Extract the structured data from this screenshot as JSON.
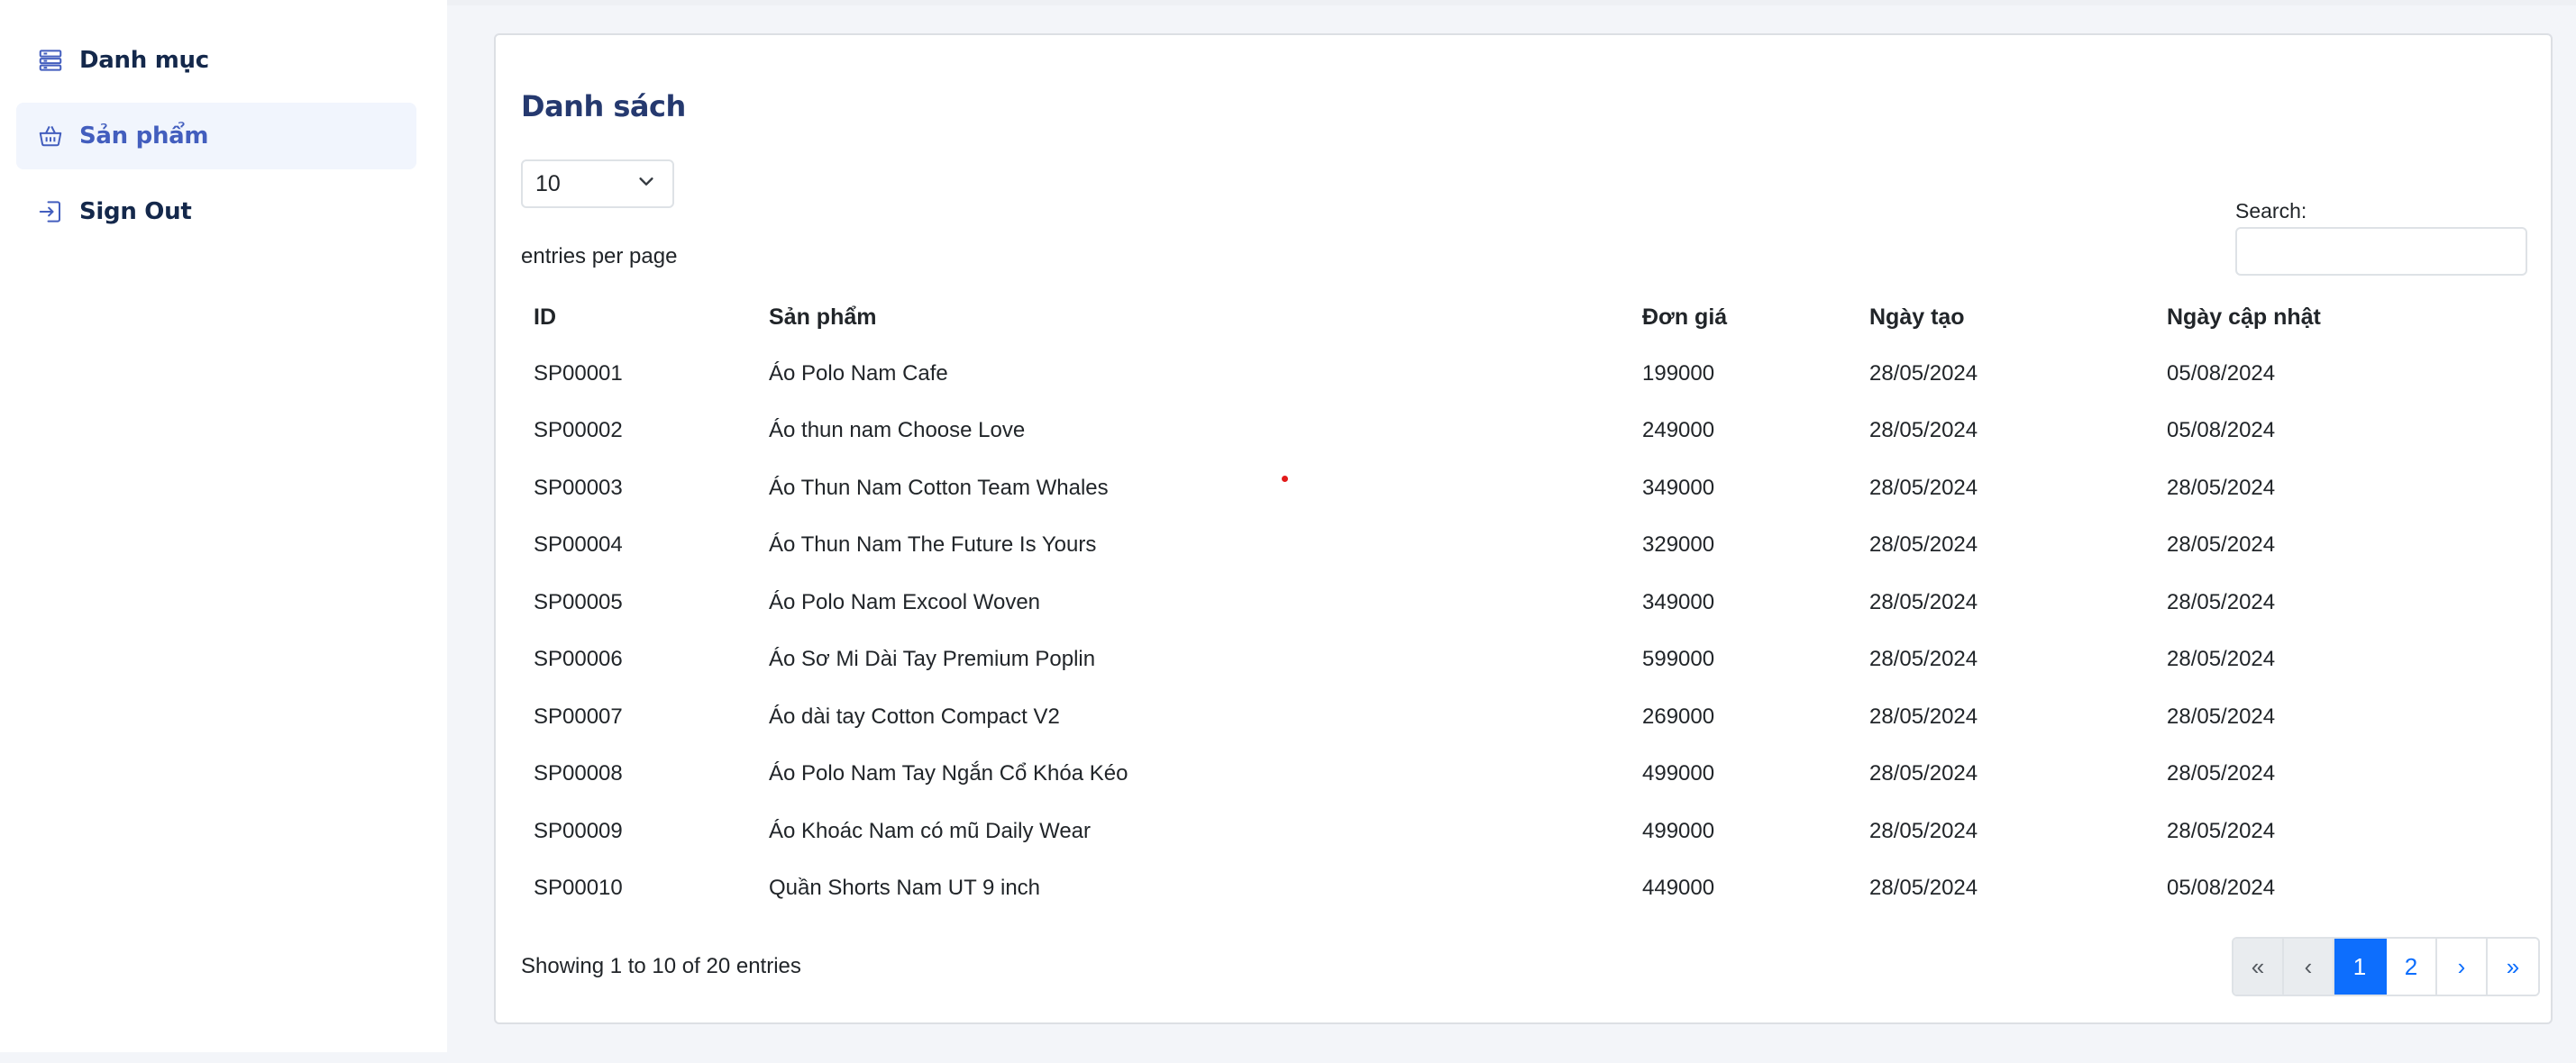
{
  "sidebar": {
    "items": [
      {
        "label": "Danh mục",
        "icon": "list-icon",
        "active": false
      },
      {
        "label": "Sản phẩm",
        "icon": "basket-icon",
        "active": true
      },
      {
        "label": "Sign Out",
        "icon": "sign-out-icon",
        "active": false
      }
    ]
  },
  "card": {
    "title": "Danh sách",
    "length_select": {
      "value": "10",
      "label": "entries per page"
    },
    "search": {
      "label": "Search:",
      "value": ""
    },
    "table": {
      "headers": [
        "ID",
        "Sản phẩm",
        "Đơn giá",
        "Ngày tạo",
        "Ngày cập nhật"
      ],
      "rows": [
        [
          "SP00001",
          "Áo Polo Nam Cafe",
          "199000",
          "28/05/2024",
          "05/08/2024"
        ],
        [
          "SP00002",
          "Áo thun nam Choose Love",
          "249000",
          "28/05/2024",
          "05/08/2024"
        ],
        [
          "SP00003",
          "Áo Thun Nam Cotton Team Whales",
          "349000",
          "28/05/2024",
          "28/05/2024"
        ],
        [
          "SP00004",
          "Áo Thun Nam The Future Is Yours",
          "329000",
          "28/05/2024",
          "28/05/2024"
        ],
        [
          "SP00005",
          "Áo Polo Nam Excool Woven",
          "349000",
          "28/05/2024",
          "28/05/2024"
        ],
        [
          "SP00006",
          "Áo Sơ Mi Dài Tay Premium Poplin",
          "599000",
          "28/05/2024",
          "28/05/2024"
        ],
        [
          "SP00007",
          "Áo dài tay Cotton Compact V2",
          "269000",
          "28/05/2024",
          "28/05/2024"
        ],
        [
          "SP00008",
          "Áo Polo Nam Tay Ngắn Cổ Khóa Kéo",
          "499000",
          "28/05/2024",
          "28/05/2024"
        ],
        [
          "SP00009",
          "Áo Khoác Nam có mũ Daily Wear",
          "499000",
          "28/05/2024",
          "28/05/2024"
        ],
        [
          "SP00010",
          "Quần Shorts Nam UT 9 inch",
          "449000",
          "28/05/2024",
          "05/08/2024"
        ]
      ]
    },
    "info": "Showing 1 to 10 of 20 entries",
    "pagination": {
      "first": "«",
      "prev": "‹",
      "pages": [
        "1",
        "2"
      ],
      "current": "1",
      "next": "›",
      "last": "»"
    }
  },
  "colors": {
    "accent": "#435ebe",
    "nav_text": "#14284b",
    "title": "#25396f",
    "page_active": "#0d6efd",
    "cursor_dot": "#e21a1a"
  }
}
